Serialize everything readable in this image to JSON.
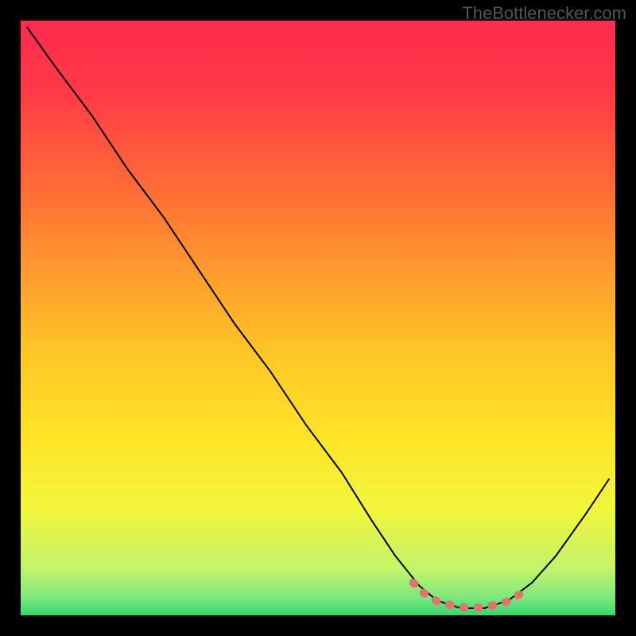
{
  "watermark": "TheBottlenecker.com",
  "chart_data": {
    "type": "line",
    "title": "",
    "xlabel": "",
    "ylabel": "",
    "xlim": [
      0,
      100
    ],
    "ylim": [
      0,
      100
    ],
    "series": [
      {
        "name": "curve",
        "color": "#000000",
        "points": [
          {
            "x": 1,
            "y": 99
          },
          {
            "x": 6,
            "y": 92
          },
          {
            "x": 12,
            "y": 84
          },
          {
            "x": 18,
            "y": 75
          },
          {
            "x": 24,
            "y": 67
          },
          {
            "x": 30,
            "y": 58
          },
          {
            "x": 36,
            "y": 49
          },
          {
            "x": 42,
            "y": 41
          },
          {
            "x": 48,
            "y": 32
          },
          {
            "x": 54,
            "y": 24
          },
          {
            "x": 59,
            "y": 16
          },
          {
            "x": 63,
            "y": 10
          },
          {
            "x": 67,
            "y": 5
          },
          {
            "x": 70,
            "y": 2.5
          },
          {
            "x": 74,
            "y": 1.2
          },
          {
            "x": 78,
            "y": 1.2
          },
          {
            "x": 82,
            "y": 2.5
          },
          {
            "x": 86,
            "y": 5.5
          },
          {
            "x": 90,
            "y": 10
          },
          {
            "x": 95,
            "y": 17
          },
          {
            "x": 99,
            "y": 23
          }
        ]
      },
      {
        "name": "highlight",
        "color": "#e0736b",
        "points": [
          {
            "x": 66,
            "y": 5.5
          },
          {
            "x": 68,
            "y": 3.6
          },
          {
            "x": 70,
            "y": 2.4
          },
          {
            "x": 72,
            "y": 1.8
          },
          {
            "x": 74,
            "y": 1.4
          },
          {
            "x": 76,
            "y": 1.2
          },
          {
            "x": 78,
            "y": 1.4
          },
          {
            "x": 80,
            "y": 1.8
          },
          {
            "x": 82,
            "y": 2.4
          },
          {
            "x": 84,
            "y": 3.6
          },
          {
            "x": 85,
            "y": 4.6
          }
        ]
      }
    ],
    "gradient_stops": [
      {
        "offset": 0.0,
        "color": "#ff2b4f"
      },
      {
        "offset": 0.12,
        "color": "#ff3a47"
      },
      {
        "offset": 0.28,
        "color": "#ff6b36"
      },
      {
        "offset": 0.42,
        "color": "#ff9a2d"
      },
      {
        "offset": 0.56,
        "color": "#ffc627"
      },
      {
        "offset": 0.7,
        "color": "#ffe427"
      },
      {
        "offset": 0.82,
        "color": "#f2f53c"
      },
      {
        "offset": 0.92,
        "color": "#c4f46a"
      },
      {
        "offset": 0.97,
        "color": "#7de87e"
      },
      {
        "offset": 1.0,
        "color": "#32d96e"
      }
    ]
  }
}
